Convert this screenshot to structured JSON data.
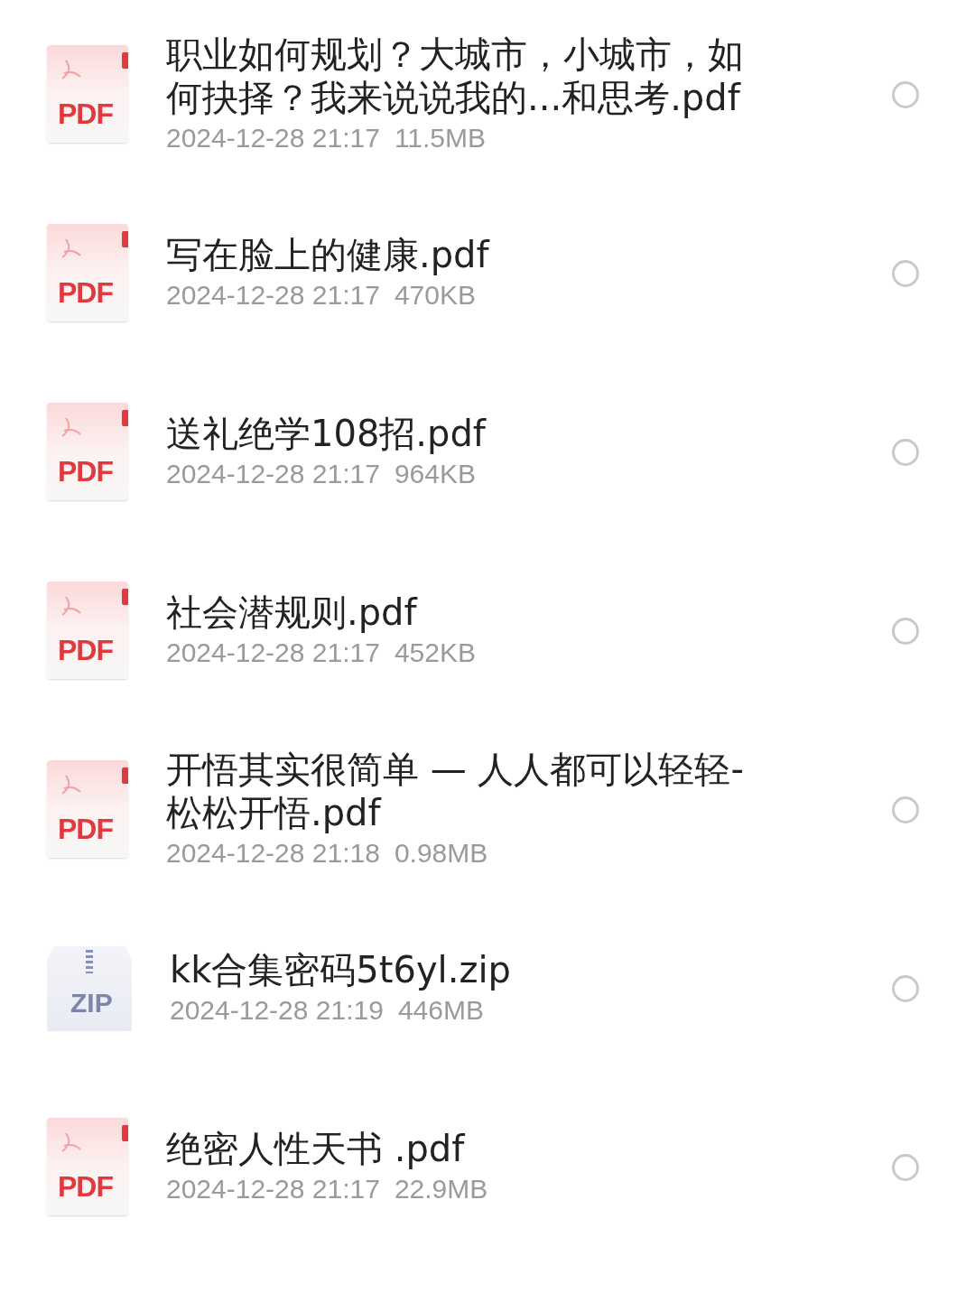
{
  "files": [
    {
      "kind": "pdf",
      "badge": "PDF",
      "name": "职业如何规划？大城市，小城市，如何抉择？我来说说我的...和思考.pdf",
      "date": "2024-12-28 21:17",
      "size": "11.5MB",
      "selected": false
    },
    {
      "kind": "pdf",
      "badge": "PDF",
      "name": "写在脸上的健康.pdf",
      "date": "2024-12-28 21:17",
      "size": "470KB",
      "selected": false
    },
    {
      "kind": "pdf",
      "badge": "PDF",
      "name": "送礼绝学108招.pdf",
      "date": "2024-12-28 21:17",
      "size": "964KB",
      "selected": false
    },
    {
      "kind": "pdf",
      "badge": "PDF",
      "name": "社会潜规则.pdf",
      "date": "2024-12-28 21:17",
      "size": "452KB",
      "selected": false
    },
    {
      "kind": "pdf",
      "badge": "PDF",
      "name": "开悟其实很简单 — 人人都可以轻轻-松松开悟.pdf",
      "date": "2024-12-28 21:18",
      "size": "0.98MB",
      "selected": false
    },
    {
      "kind": "zip",
      "badge": "ZIP",
      "name": "kk合集密码5t6yl.zip",
      "date": "2024-12-28 21:19",
      "size": "446MB",
      "selected": false
    },
    {
      "kind": "pdf",
      "badge": "PDF",
      "name": "绝密人性天书 .pdf",
      "date": "2024-12-28 21:17",
      "size": "22.9MB",
      "selected": false
    }
  ]
}
